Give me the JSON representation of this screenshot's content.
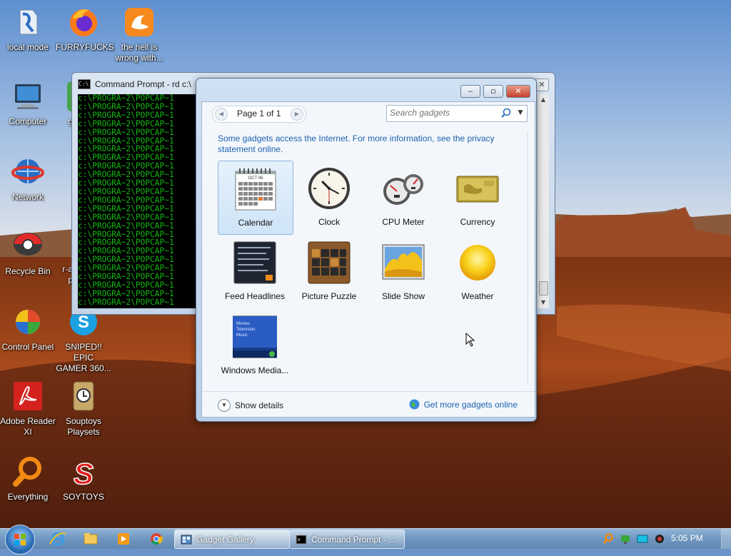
{
  "desktop": {
    "icons": [
      {
        "label": "local mode",
        "icon": "app-icon"
      },
      {
        "label": "FURRYFUCKS",
        "icon": "firefox-icon"
      },
      {
        "label": "the hell is\nwrong with...",
        "icon": "uc-browser-icon"
      },
      {
        "label": "Computer",
        "icon": "computer-icon"
      },
      {
        "label": "g",
        "icon": "app-icon"
      },
      {
        "label": "Network",
        "icon": "network-icon"
      },
      {
        "label": "Recycle Bin",
        "icon": "recycle-bin-icon"
      },
      {
        "label": "r-a\np",
        "icon": "app-icon"
      },
      {
        "label": "Control Panel",
        "icon": "control-panel-icon"
      },
      {
        "label": "SNIPED!! EPIC\nGAMER 360...",
        "icon": "skype-icon"
      },
      {
        "label": "Adobe Reader\nXI",
        "icon": "adobe-reader-icon"
      },
      {
        "label": "Souptoys\nPlaysets",
        "icon": "souptoys-icon"
      },
      {
        "label": "Everything",
        "icon": "search-icon"
      },
      {
        "label": "SOYTOYS",
        "icon": "soytoys-icon"
      }
    ]
  },
  "cmd": {
    "title": "Command Prompt - rd  c:\\",
    "line_text": "c:\\PROGRA~2\\POPCAP~1",
    "line_count": 25,
    "text_color": "#11b511"
  },
  "gallery": {
    "title": "Gadget Gallery",
    "page_label": "Page 1 of 1",
    "search_placeholder": "Search gadgets",
    "notice": "Some gadgets access the Internet.  For more information, see the privacy statement online.",
    "gadgets": [
      {
        "label": "Calendar",
        "icon": "calendar-icon",
        "selected": true,
        "calendar_month": "OCT 06"
      },
      {
        "label": "Clock",
        "icon": "clock-icon",
        "selected": false
      },
      {
        "label": "CPU Meter",
        "icon": "cpu-meter-icon",
        "selected": false
      },
      {
        "label": "Currency",
        "icon": "currency-icon",
        "selected": false
      },
      {
        "label": "Feed Headlines",
        "icon": "feed-headlines-icon",
        "selected": false
      },
      {
        "label": "Picture Puzzle",
        "icon": "picture-puzzle-icon",
        "selected": false
      },
      {
        "label": "Slide Show",
        "icon": "slide-show-icon",
        "selected": false
      },
      {
        "label": "Weather",
        "icon": "weather-icon",
        "selected": false
      },
      {
        "label": "Windows Media...",
        "icon": "windows-media-center-icon",
        "selected": false,
        "thumb_lines": [
          "Movies",
          "Television",
          "Music"
        ]
      }
    ],
    "show_details": "Show details",
    "get_more": "Get more gadgets online"
  },
  "taskbar": {
    "pinned": [
      "internet-explorer-icon",
      "folder-icon",
      "media-player-icon",
      "chrome-icon"
    ],
    "tasks": [
      {
        "label": "Gadget Gallery",
        "icon": "gadget-gallery-icon",
        "active": true
      },
      {
        "label": "Command Prompt - ...",
        "icon": "cmd-icon",
        "active": false
      }
    ],
    "tray": [
      "everything-tray-icon",
      "network-tray-icon",
      "display-tray-icon",
      "volume-tray-icon"
    ],
    "clock": "5:05 PM"
  },
  "colors": {
    "link": "#1c61b0",
    "close_button": "#c5402a",
    "console_bg": "#000000"
  }
}
